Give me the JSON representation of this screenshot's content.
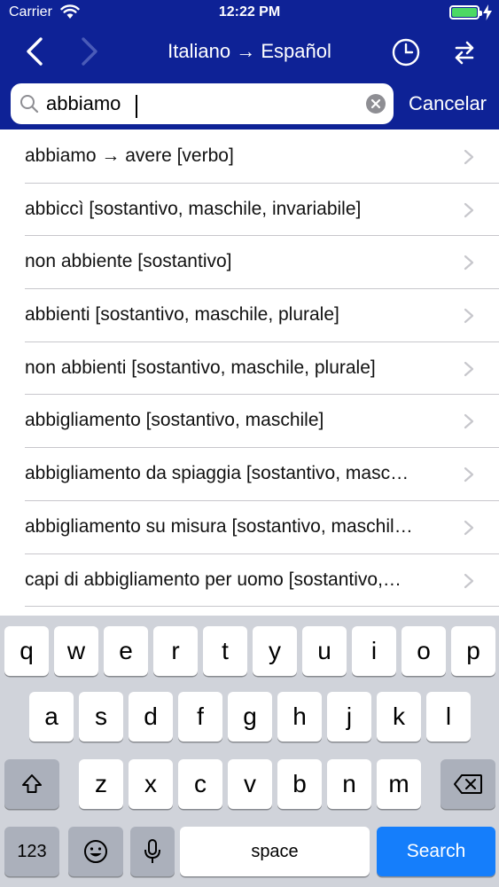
{
  "status_bar": {
    "carrier": "Carrier",
    "time": "12:22 PM",
    "battery_color": "#4cd964"
  },
  "nav": {
    "title": "Italiano → Español"
  },
  "search": {
    "value": "abbiamo",
    "cancel_label": "Cancelar"
  },
  "results": [
    "abbiamo → avere [verbo]",
    "abbiccì [sostantivo, maschile, invariabile]",
    "non abbiente [sostantivo]",
    "abbienti [sostantivo, maschile, plurale]",
    "non abbienti [sostantivo, maschile, plurale]",
    "abbigliamento [sostantivo, maschile]",
    "abbigliamento da spiaggia [sostantivo, masc…",
    "abbigliamento su misura [sostantivo, maschil…",
    "capi di abbigliamento per uomo [sostantivo,…",
    ""
  ],
  "keyboard": {
    "row1": [
      "q",
      "w",
      "e",
      "r",
      "t",
      "y",
      "u",
      "i",
      "o",
      "p"
    ],
    "row2": [
      "a",
      "s",
      "d",
      "f",
      "g",
      "h",
      "j",
      "k",
      "l"
    ],
    "row3": [
      "z",
      "x",
      "c",
      "v",
      "b",
      "n",
      "m"
    ],
    "numbers_label": "123",
    "space_label": "space",
    "search_label": "Search"
  },
  "colors": {
    "header": "#0e2296",
    "search_key": "#157efb",
    "keyboard_bg": "#d0d3da"
  }
}
